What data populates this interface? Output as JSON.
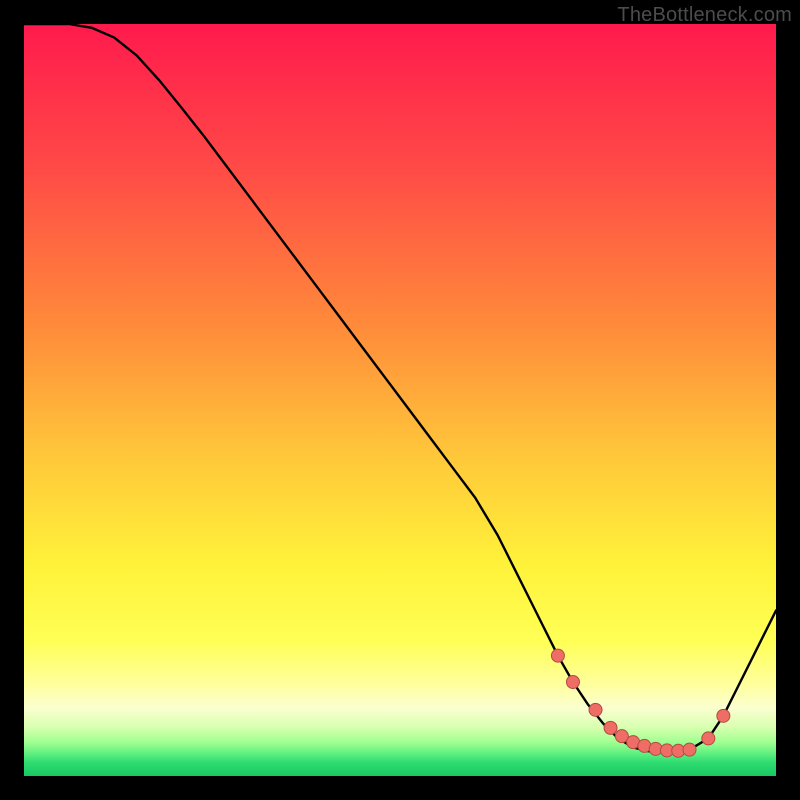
{
  "attribution": "TheBottleneck.com",
  "colors": {
    "curve": "#000000",
    "dot_fill": "#ee6e66",
    "dot_stroke": "#b44a44"
  },
  "chart_data": {
    "type": "line",
    "title": "",
    "xlabel": "",
    "ylabel": "",
    "xlim": [
      0,
      100
    ],
    "ylim": [
      0,
      100
    ],
    "x": [
      0,
      3,
      6,
      9,
      12,
      15,
      18,
      21,
      24,
      27,
      30,
      33,
      36,
      39,
      42,
      45,
      48,
      51,
      54,
      57,
      60,
      63,
      65,
      67,
      69,
      71,
      73,
      75,
      77,
      79,
      81,
      83,
      85,
      87,
      89,
      91,
      93,
      95,
      97,
      100
    ],
    "values": [
      100,
      100,
      100,
      99.5,
      98.2,
      95.8,
      92.5,
      88.8,
      85.0,
      81.0,
      77.0,
      73.0,
      69.0,
      65.0,
      61.0,
      57.0,
      53.0,
      49.0,
      45.0,
      41.0,
      37.0,
      32.0,
      28.0,
      24.0,
      20.0,
      16.0,
      12.5,
      9.5,
      7.0,
      5.0,
      3.8,
      3.3,
      3.2,
      3.35,
      3.8,
      5.0,
      8.0,
      12.0,
      16.0,
      22.0
    ],
    "marker_points": {
      "x": [
        71,
        73,
        76,
        78,
        79.5,
        81,
        82.5,
        84,
        85.5,
        87,
        88.5,
        91,
        93
      ],
      "y": [
        16.0,
        12.5,
        8.8,
        6.4,
        5.3,
        4.5,
        4.0,
        3.6,
        3.4,
        3.35,
        3.5,
        5.0,
        8.0
      ]
    }
  }
}
